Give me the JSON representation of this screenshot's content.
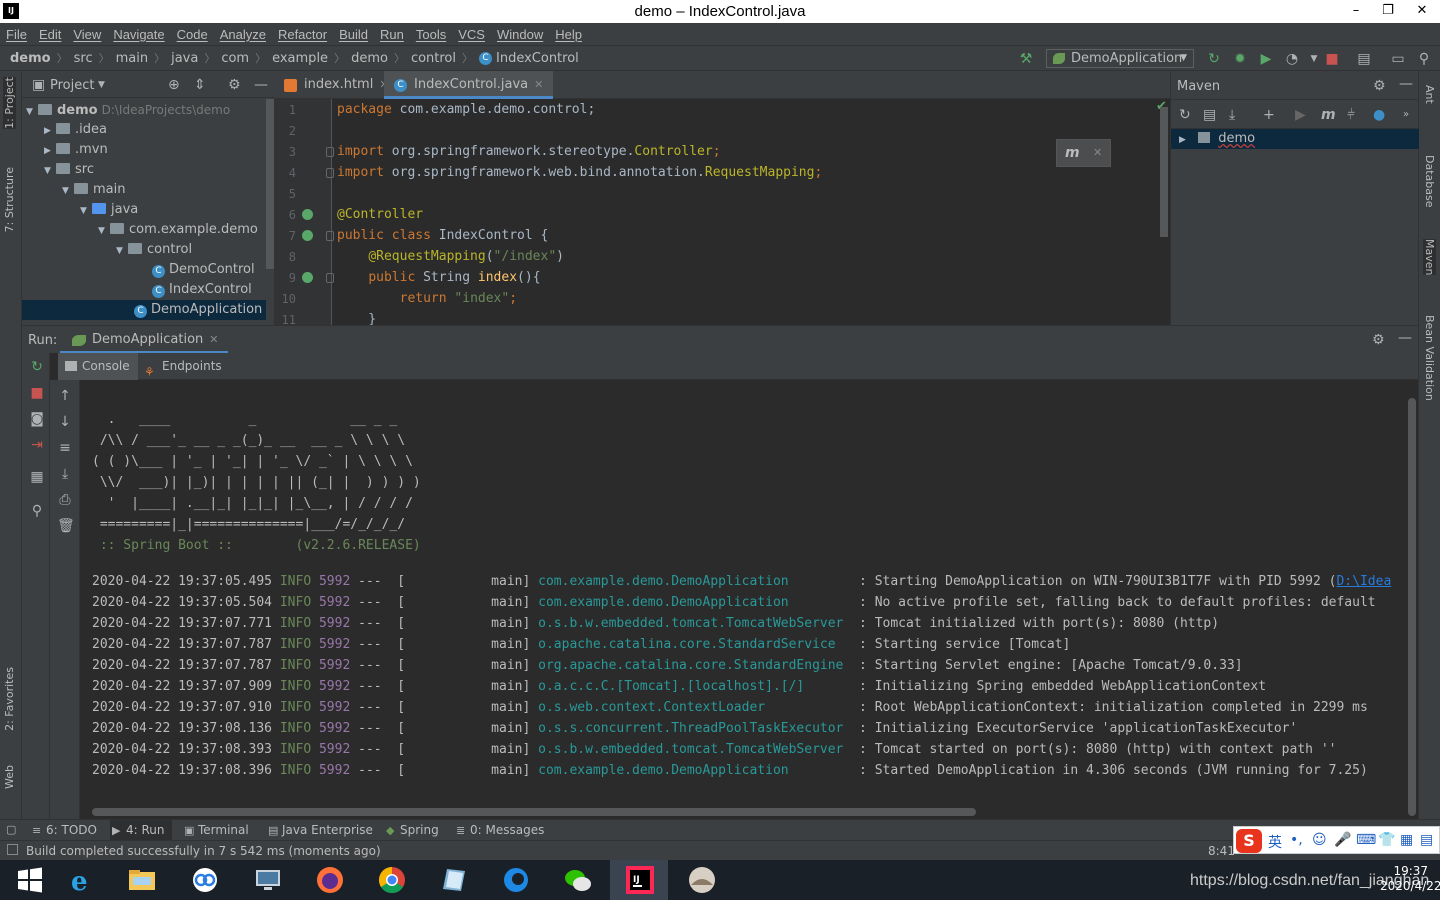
{
  "window": {
    "title": "demo – IndexControl.java",
    "app_icon": "IJ"
  },
  "menu": [
    "File",
    "Edit",
    "View",
    "Navigate",
    "Code",
    "Analyze",
    "Refactor",
    "Build",
    "Run",
    "Tools",
    "VCS",
    "Window",
    "Help"
  ],
  "breadcrumb": [
    "demo",
    "src",
    "main",
    "java",
    "com",
    "example",
    "demo",
    "control",
    "IndexControl"
  ],
  "run_config": "DemoApplication",
  "left_stripe": {
    "project": "1: Project",
    "structure": "7: Structure",
    "favorites": "2: Favorites",
    "web": "Web"
  },
  "right_stripe": {
    "ant": "Ant",
    "database": "Database",
    "maven": "Maven",
    "bean_validation": "Bean Validation"
  },
  "project": {
    "title": "Project",
    "tree": [
      {
        "label": "demo",
        "path": "D:\\IdeaProjects\\demo"
      },
      {
        "label": ".idea"
      },
      {
        "label": ".mvn"
      },
      {
        "label": "src"
      },
      {
        "label": "main"
      },
      {
        "label": "java"
      },
      {
        "label": "com.example.demo"
      },
      {
        "label": "control"
      },
      {
        "label": "DemoControl"
      },
      {
        "label": "IndexControl"
      },
      {
        "label": "DemoApplication"
      }
    ]
  },
  "editor": {
    "tabs": [
      "index.html",
      "IndexControl.java"
    ],
    "line_numbers": [
      "1",
      "2",
      "3",
      "4",
      "5",
      "6",
      "7",
      "8",
      "9",
      "10",
      "11"
    ],
    "code": {
      "l1_kw": "package",
      "l1_rest": " com.example.demo.control;",
      "l3_kw": "import",
      "l3_rest": " org.springframework.stereotype.",
      "l3_ann": "Controller",
      "l3_end": ";",
      "l4_kw": "import",
      "l4_rest": " org.springframework.web.bind.annotation.",
      "l4_ann": "RequestMapping",
      "l4_end": ";",
      "l6_ann": "@Controller",
      "l7_kw": "public class",
      "l7_rest": " IndexControl {",
      "l8_ann": "@RequestMapping",
      "l8_p1": "(",
      "l8_str": "\"/index\"",
      "l8_p2": ")",
      "l9_kw": "public",
      "l9_rest": " String ",
      "l9_fn": "index",
      "l9_end": "(){",
      "l10_kw": "return",
      "l10_str": " \"index\"",
      "l10_end": ";",
      "l11": "    }"
    }
  },
  "maven": {
    "title": "Maven",
    "project": "demo"
  },
  "run": {
    "label": "Run:",
    "tab": "DemoApplication",
    "subtabs": [
      "Console",
      "Endpoints"
    ],
    "banner": [
      "  .   ____          _            __ _ _",
      " /\\\\ / ___'_ __ _ _(_)_ __  __ _ \\ \\ \\ \\",
      "( ( )\\___ | '_ | '_| | '_ \\/ _` | \\ \\ \\ \\",
      " \\\\/  ___)| |_)| | | | | || (_| |  ) ) ) )",
      "  '  |____| .__|_| |_|_| |_\\__, | / / / /",
      " =========|_|==============|___/=/_/_/_/",
      " :: Spring Boot ::        (v2.2.6.RELEASE)"
    ],
    "logs": [
      {
        "ts": "2020-04-22 19:37:05.495",
        "level": "INFO",
        "pid": "5992",
        "thread": "---  [           main]",
        "logger": "com.example.demo.DemoApplication        ",
        "msg": " : Starting DemoApplication on WIN-790UI3B1T7F with PID 5992 (",
        "link": "D:\\Idea"
      },
      {
        "ts": "2020-04-22 19:37:05.504",
        "level": "INFO",
        "pid": "5992",
        "thread": "---  [           main]",
        "logger": "com.example.demo.DemoApplication        ",
        "msg": " : No active profile set, falling back to default profiles: default",
        "link": ""
      },
      {
        "ts": "2020-04-22 19:37:07.771",
        "level": "INFO",
        "pid": "5992",
        "thread": "---  [           main]",
        "logger": "o.s.b.w.embedded.tomcat.TomcatWebServer ",
        "msg": " : Tomcat initialized with port(s): 8080 (http)",
        "link": ""
      },
      {
        "ts": "2020-04-22 19:37:07.787",
        "level": "INFO",
        "pid": "5992",
        "thread": "---  [           main]",
        "logger": "o.apache.catalina.core.StandardService  ",
        "msg": " : Starting service [Tomcat]",
        "link": ""
      },
      {
        "ts": "2020-04-22 19:37:07.787",
        "level": "INFO",
        "pid": "5992",
        "thread": "---  [           main]",
        "logger": "org.apache.catalina.core.StandardEngine ",
        "msg": " : Starting Servlet engine: [Apache Tomcat/9.0.33]",
        "link": ""
      },
      {
        "ts": "2020-04-22 19:37:07.909",
        "level": "INFO",
        "pid": "5992",
        "thread": "---  [           main]",
        "logger": "o.a.c.c.C.[Tomcat].[localhost].[/]      ",
        "msg": " : Initializing Spring embedded WebApplicationContext",
        "link": ""
      },
      {
        "ts": "2020-04-22 19:37:07.910",
        "level": "INFO",
        "pid": "5992",
        "thread": "---  [           main]",
        "logger": "o.s.web.context.ContextLoader           ",
        "msg": " : Root WebApplicationContext: initialization completed in 2299 ms",
        "link": ""
      },
      {
        "ts": "2020-04-22 19:37:08.136",
        "level": "INFO",
        "pid": "5992",
        "thread": "---  [           main]",
        "logger": "o.s.s.concurrent.ThreadPoolTaskExecutor ",
        "msg": " : Initializing ExecutorService 'applicationTaskExecutor'",
        "link": ""
      },
      {
        "ts": "2020-04-22 19:37:08.393",
        "level": "INFO",
        "pid": "5992",
        "thread": "---  [           main]",
        "logger": "o.s.b.w.embedded.tomcat.TomcatWebServer ",
        "msg": " : Tomcat started on port(s): 8080 (http) with context path ''",
        "link": ""
      },
      {
        "ts": "2020-04-22 19:37:08.396",
        "level": "INFO",
        "pid": "5992",
        "thread": "---  [           main]",
        "logger": "com.example.demo.DemoApplication        ",
        "msg": " : Started DemoApplication in 4.306 seconds (JVM running for 7.25)",
        "link": ""
      }
    ]
  },
  "bottom_tabs": [
    "6: TODO",
    "4: Run",
    "Terminal",
    "Java Enterprise",
    "Spring",
    "0: Messages"
  ],
  "status": {
    "message": "Build completed successfully in 7 s 542 ms (moments ago)",
    "position": "8:41"
  },
  "ime": {
    "mode": "英"
  },
  "taskbar": {
    "clock_time": "19:37",
    "clock_date": "2020/4/22",
    "watermark": "https://blog.csdn.net/fan_jianghan"
  },
  "colors": {
    "accent": "#4a88c7",
    "keyword": "#cc7832",
    "annotation": "#bbb529",
    "string": "#6a8759",
    "logger": "#299999",
    "pid": "#9876aa"
  }
}
